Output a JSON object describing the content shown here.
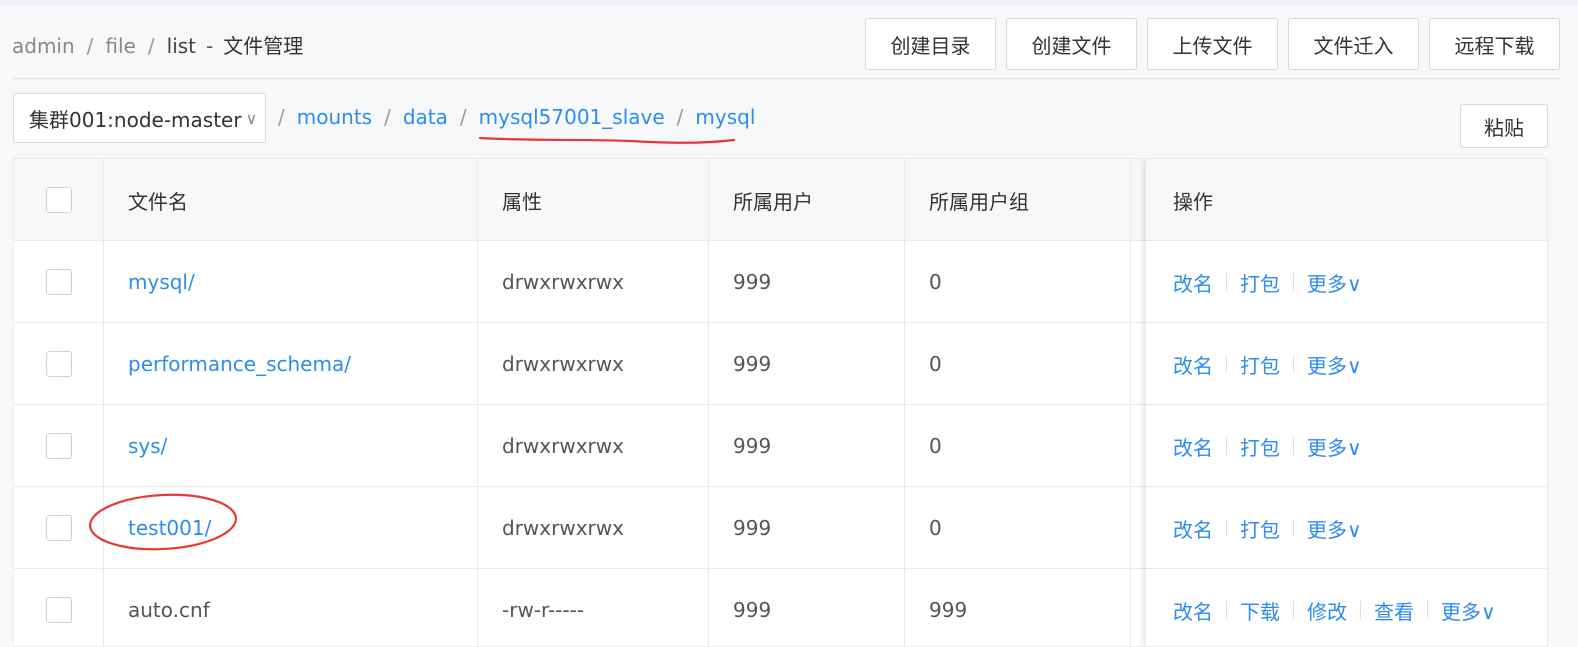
{
  "breadcrumb": {
    "items": [
      "admin",
      "file",
      "list"
    ],
    "dash": "-",
    "title": "文件管理"
  },
  "toolbar": {
    "buttons": [
      "创建目录",
      "创建文件",
      "上传文件",
      "文件迁入",
      "远程下载"
    ]
  },
  "node_select": {
    "value": "集群001:node-master",
    "chevron": "∨"
  },
  "path": {
    "segments": [
      "mounts",
      "data",
      "mysql57001_slave",
      "mysql"
    ]
  },
  "paste_label": "粘贴",
  "table": {
    "headers": [
      "文件名",
      "属性",
      "所属用户",
      "所属用户组",
      "操作"
    ],
    "rows": [
      {
        "name": "mysql/",
        "perm": "drwxrwxrwx",
        "owner": "999",
        "group": "0",
        "ops": [
          "改名",
          "打包",
          "更多∨"
        ]
      },
      {
        "name": "performance_schema/",
        "perm": "drwxrwxrwx",
        "owner": "999",
        "group": "0",
        "ops": [
          "改名",
          "打包",
          "更多∨"
        ]
      },
      {
        "name": "sys/",
        "perm": "drwxrwxrwx",
        "owner": "999",
        "group": "0",
        "ops": [
          "改名",
          "打包",
          "更多∨"
        ]
      },
      {
        "name": "test001/",
        "perm": "drwxrwxrwx",
        "owner": "999",
        "group": "0",
        "ops": [
          "改名",
          "打包",
          "更多∨"
        ]
      },
      {
        "name": "auto.cnf",
        "perm": "-rw-r-----",
        "owner": "999",
        "group": "999",
        "ops": [
          "改名",
          "下载",
          "修改",
          "查看",
          "更多∨"
        ]
      }
    ]
  },
  "colors": {
    "link": "#2d8cf0",
    "annotation": "#e53935"
  }
}
